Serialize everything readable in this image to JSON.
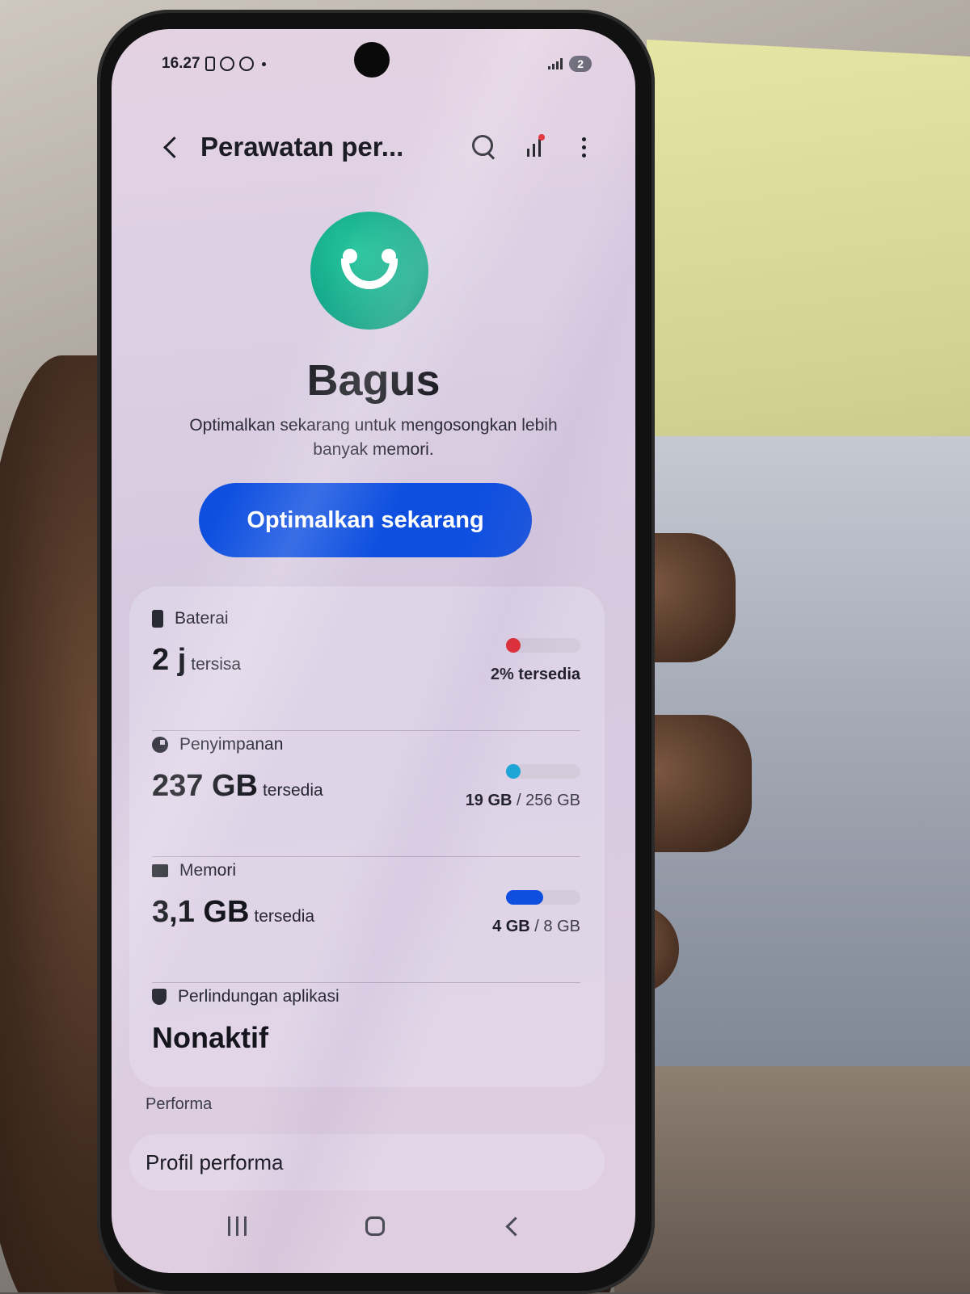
{
  "status_bar": {
    "time": "16.27",
    "badge": "2"
  },
  "app_bar": {
    "title": "Perawatan per..."
  },
  "hero": {
    "status": "Bagus",
    "message": "Optimalkan sekarang untuk mengosongkan lebih banyak memori.",
    "button_label": "Optimalkan sekarang"
  },
  "items": [
    {
      "label": "Baterai",
      "value": "2 j",
      "unit": "tersisa",
      "detail_bold": "2% tersedia",
      "detail_rest": "",
      "level": 0.02,
      "color": "#e0282f"
    },
    {
      "label": "Penyimpanan",
      "value": "237 GB",
      "unit": "tersedia",
      "detail_bold": "19 GB",
      "detail_rest": " / 256 GB",
      "level": 0.074,
      "color": "#1ba6d6"
    },
    {
      "label": "Memori",
      "value": "3,1 GB",
      "unit": "tersedia",
      "detail_bold": "4 GB",
      "detail_rest": " / 8 GB",
      "level": 0.5,
      "color": "#0e4fe0"
    },
    {
      "label": "Perlindungan aplikasi",
      "value": "Nonaktif"
    }
  ],
  "performance": {
    "section_label": "Performa",
    "profile_label": "Profil performa"
  },
  "colors": {
    "accent": "#0e4fe0",
    "good": "#12a889"
  }
}
